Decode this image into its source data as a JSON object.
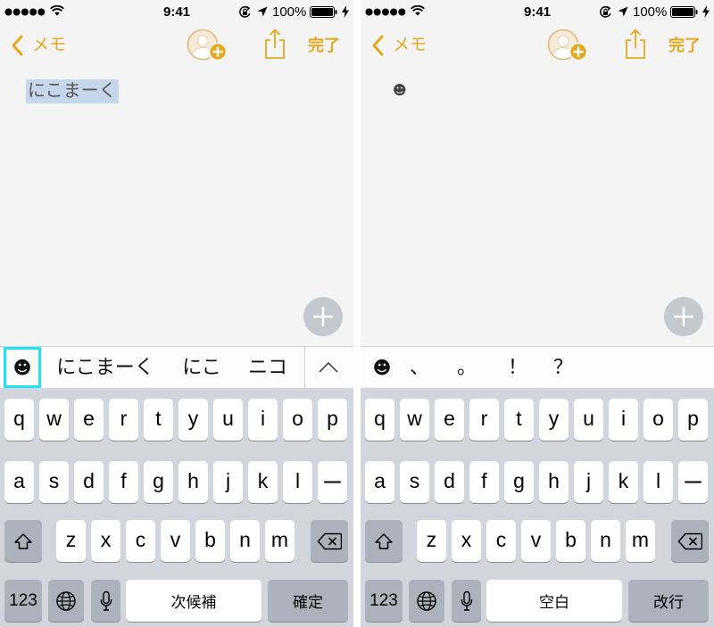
{
  "colors": {
    "accent": "#E5A81E",
    "highlight": "#1FE3F0",
    "keyboard_bg": "#D2D5DB",
    "key_gray": "#ABB2BB",
    "selection": "#C6D7EC"
  },
  "status_bar": {
    "time": "9:41",
    "battery_percent": "100%",
    "icons": [
      "signal-icon",
      "wifi-icon",
      "rotation-lock-icon",
      "location-icon",
      "battery-icon",
      "charging-icon"
    ]
  },
  "nav": {
    "back_label": "メモ",
    "done_label": "完了",
    "icons": [
      "chevron-left-icon",
      "add-person-icon",
      "share-icon"
    ]
  },
  "note_area": {
    "icons": [
      "plus-icon"
    ]
  },
  "keyboard": {
    "row1": [
      "q",
      "w",
      "e",
      "r",
      "t",
      "y",
      "u",
      "i",
      "o",
      "p"
    ],
    "row2": [
      "a",
      "s",
      "d",
      "f",
      "g",
      "h",
      "j",
      "k",
      "l",
      "ー"
    ],
    "row3": [
      "z",
      "x",
      "c",
      "v",
      "b",
      "n",
      "m"
    ],
    "numbers_label": "123",
    "icons": [
      "shift-icon",
      "delete-icon",
      "globe-icon",
      "mic-icon"
    ]
  },
  "panels": [
    {
      "note": {
        "text": "にこまーく",
        "selected": true
      },
      "suggestions": {
        "emoji": "☻",
        "emoji_highlighted": true,
        "candidates": [
          "にこまーく",
          "にこ",
          "ニコ"
        ],
        "expand_icon": "chevron-up-icon"
      },
      "keys": {
        "space_label": "次候補",
        "return_label": "確定"
      }
    },
    {
      "note": {
        "text": "☻",
        "selected": false
      },
      "suggestions": {
        "emoji": "☻",
        "emoji_highlighted": false,
        "candidates": [
          "、",
          "。",
          "！",
          "？"
        ]
      },
      "keys": {
        "space_label": "空白",
        "return_label": "改行"
      }
    }
  ]
}
